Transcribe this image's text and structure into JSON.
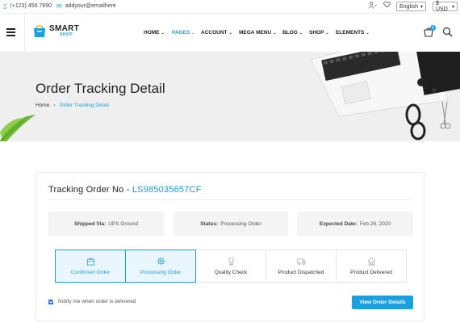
{
  "topbar": {
    "phone": "(+123) 456 7890",
    "email": "addyour@emailhere",
    "language": "English",
    "currency": "$ USD"
  },
  "header": {
    "logo_main": "SMART",
    "logo_sub": "SHOP",
    "nav": [
      {
        "label": "HOME",
        "active": false
      },
      {
        "label": "PAGES",
        "active": true
      },
      {
        "label": "ACCOUNT",
        "active": false
      },
      {
        "label": "MEGA MENU",
        "active": false
      },
      {
        "label": "BLOG",
        "active": false
      },
      {
        "label": "SHOP",
        "active": false
      },
      {
        "label": "ELEMENTS",
        "active": false
      }
    ],
    "cart_count": "0"
  },
  "hero": {
    "title": "Order Tracking Detail",
    "breadcrumb_home": "Home",
    "breadcrumb_current": "Order Tracking Detail"
  },
  "order": {
    "title_prefix": "Tracking Order No - ",
    "number": "LS985035657CF",
    "shipped_via_label": "Shipped Via:",
    "shipped_via_value": "UPS Ground",
    "status_label": "Status:",
    "status_value": "Processing Order",
    "expected_label": "Expected Date:",
    "expected_value": "Feb 26, 2020",
    "steps": [
      {
        "label": "Confirmed Order",
        "icon": "bag-icon",
        "done": true
      },
      {
        "label": "Processing Order",
        "icon": "gear-icon",
        "done": true
      },
      {
        "label": "Quality Check",
        "icon": "badge-icon",
        "done": false
      },
      {
        "label": "Product Dispatched",
        "icon": "truck-icon",
        "done": false
      },
      {
        "label": "Product Delivered",
        "icon": "home-icon",
        "done": false
      }
    ],
    "notify_label": "Notify me when order is delivered",
    "notify_checked": true,
    "view_button": "View Order Details"
  },
  "colors": {
    "accent": "#1aa0e0",
    "hero_bg": "#efefef"
  }
}
